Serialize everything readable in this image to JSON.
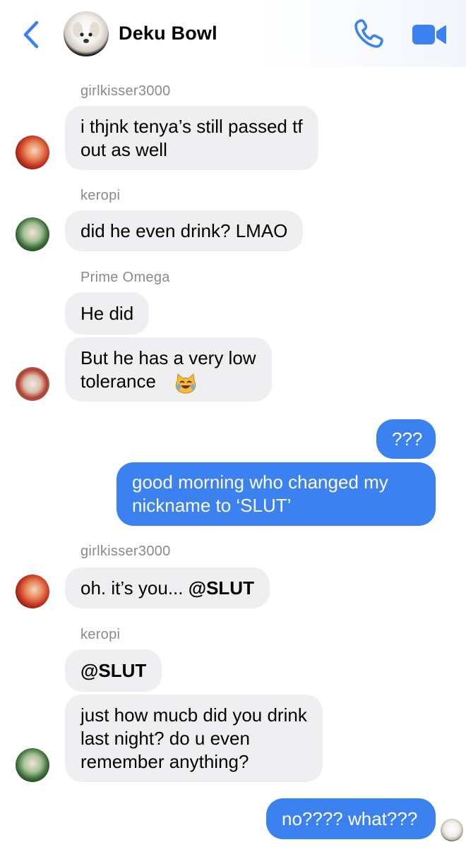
{
  "header": {
    "title": "Deku Bowl",
    "back_icon": "chevron-left-icon",
    "call_icon": "phone-icon",
    "video_icon": "video-camera-icon",
    "accent_color": "#3b82f0"
  },
  "messages": {
    "s1": "girlkisser3000",
    "m1": "i thjnk tenya’s still passed tf\nout as well",
    "s2": "keropi",
    "m2": "did he even drink? LMAO",
    "s3": "Prime Omega",
    "m3": "He did",
    "m4": "But he has a very low\ntolerance",
    "m4_emoji": "face-with-tears-of-joy-cat-emoji",
    "o1": "???",
    "o2": "good morning who changed my\nnickname to ‘SLUT’",
    "s4": "girlkisser3000",
    "m5_prefix": "oh. it’s you... ",
    "m5_mention": "@SLUT",
    "s5": "keropi",
    "m6_mention": "@SLUT",
    "m7": "just how mucb did you drink\nlast night? do u even\nremember anything?",
    "o3": "no???? what???"
  },
  "colors": {
    "incoming_bubble": "#efeff1",
    "outgoing_bubble": "#3b82f0",
    "sender_name": "#8a8a8e"
  }
}
